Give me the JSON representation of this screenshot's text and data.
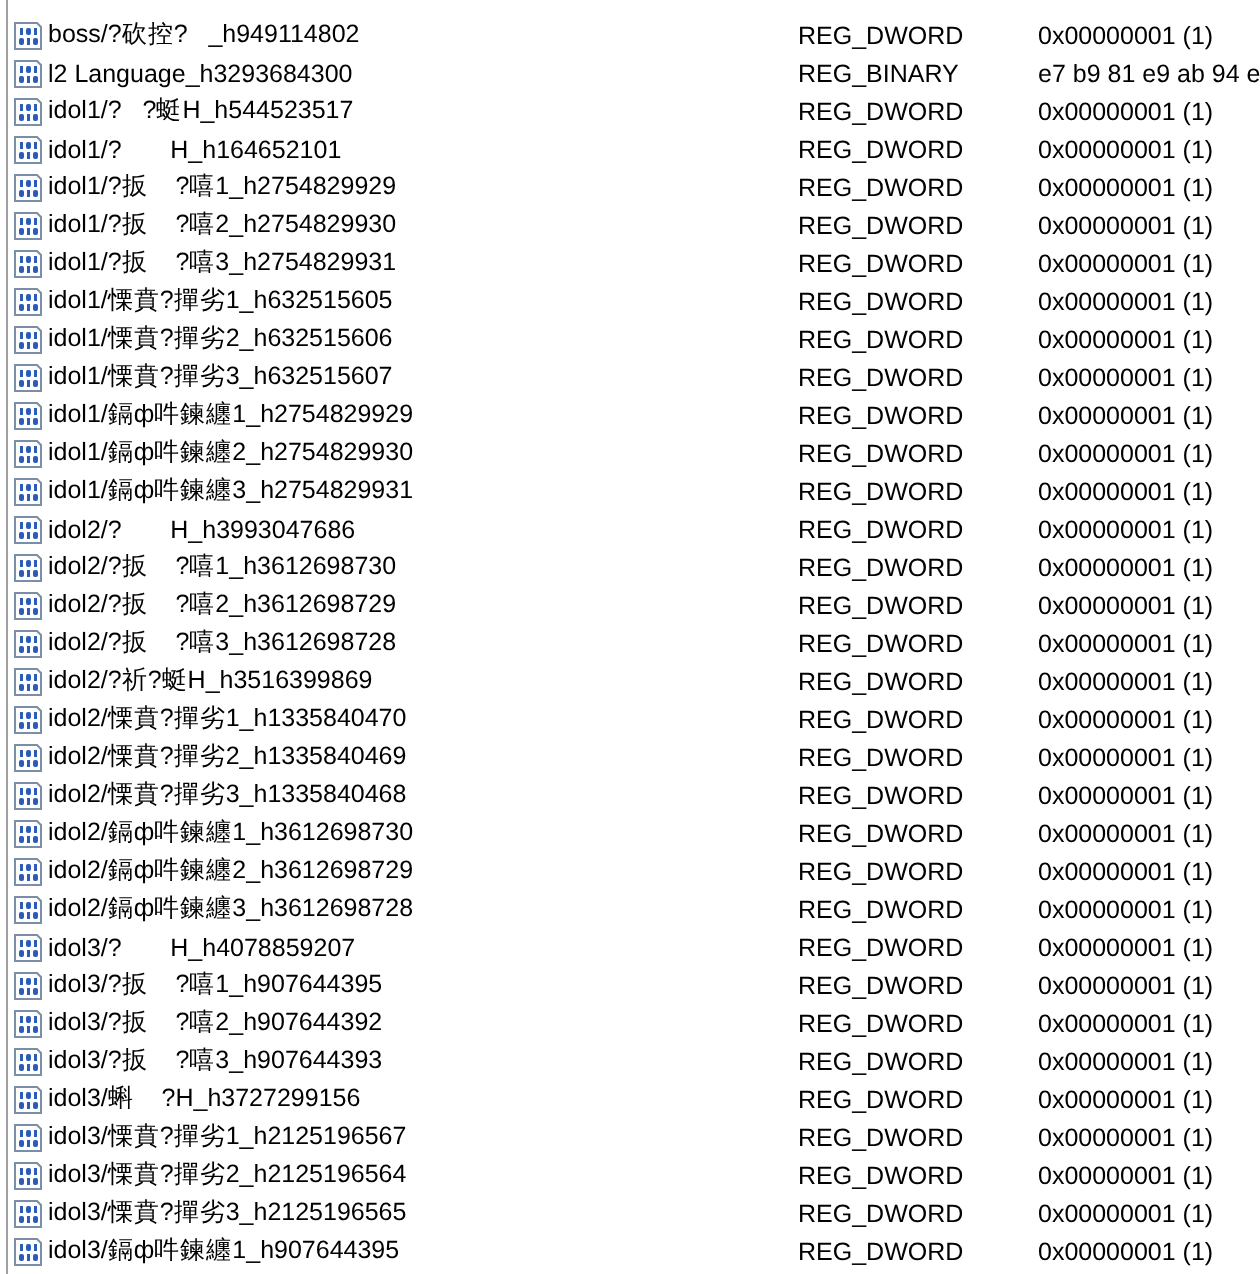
{
  "values": [
    {
      "name": "boss/?砍控?   _h949114802",
      "type": "REG_DWORD",
      "data": "0x00000001 (1)"
    },
    {
      "name": "l2 Language_h3293684300",
      "type": "REG_BINARY",
      "data": "e7 b9 81 e9 ab 94 e"
    },
    {
      "name": "idol1/?   ?蜓H_h544523517",
      "type": "REG_DWORD",
      "data": "0x00000001 (1)"
    },
    {
      "name": "idol1/?       H_h164652101",
      "type": "REG_DWORD",
      "data": "0x00000001 (1)"
    },
    {
      "name": "idol1/?扳    ?嘻1_h2754829929",
      "type": "REG_DWORD",
      "data": "0x00000001 (1)"
    },
    {
      "name": "idol1/?扳    ?嘻2_h2754829930",
      "type": "REG_DWORD",
      "data": "0x00000001 (1)"
    },
    {
      "name": "idol1/?扳    ?嘻3_h2754829931",
      "type": "REG_DWORD",
      "data": "0x00000001 (1)"
    },
    {
      "name": "idol1/慄賁?撣劣1_h632515605",
      "type": "REG_DWORD",
      "data": "0x00000001 (1)"
    },
    {
      "name": "idol1/慄賁?撣劣2_h632515606",
      "type": "REG_DWORD",
      "data": "0x00000001 (1)"
    },
    {
      "name": "idol1/慄賁?撣劣3_h632515607",
      "type": "REG_DWORD",
      "data": "0x00000001 (1)"
    },
    {
      "name": "idol1/鎘ф吽鍊纏1_h2754829929",
      "type": "REG_DWORD",
      "data": "0x00000001 (1)"
    },
    {
      "name": "idol1/鎘ф吽鍊纏2_h2754829930",
      "type": "REG_DWORD",
      "data": "0x00000001 (1)"
    },
    {
      "name": "idol1/鎘ф吽鍊纏3_h2754829931",
      "type": "REG_DWORD",
      "data": "0x00000001 (1)"
    },
    {
      "name": "idol2/?       H_h3993047686",
      "type": "REG_DWORD",
      "data": "0x00000001 (1)"
    },
    {
      "name": "idol2/?扳    ?嘻1_h3612698730",
      "type": "REG_DWORD",
      "data": "0x00000001 (1)"
    },
    {
      "name": "idol2/?扳    ?嘻2_h3612698729",
      "type": "REG_DWORD",
      "data": "0x00000001 (1)"
    },
    {
      "name": "idol2/?扳    ?嘻3_h3612698728",
      "type": "REG_DWORD",
      "data": "0x00000001 (1)"
    },
    {
      "name": "idol2/?祈?蜓H_h3516399869",
      "type": "REG_DWORD",
      "data": "0x00000001 (1)"
    },
    {
      "name": "idol2/慄賁?撣劣1_h1335840470",
      "type": "REG_DWORD",
      "data": "0x00000001 (1)"
    },
    {
      "name": "idol2/慄賁?撣劣2_h1335840469",
      "type": "REG_DWORD",
      "data": "0x00000001 (1)"
    },
    {
      "name": "idol2/慄賁?撣劣3_h1335840468",
      "type": "REG_DWORD",
      "data": "0x00000001 (1)"
    },
    {
      "name": "idol2/鎘ф吽鍊纏1_h3612698730",
      "type": "REG_DWORD",
      "data": "0x00000001 (1)"
    },
    {
      "name": "idol2/鎘ф吽鍊纏2_h3612698729",
      "type": "REG_DWORD",
      "data": "0x00000001 (1)"
    },
    {
      "name": "idol2/鎘ф吽鍊纏3_h3612698728",
      "type": "REG_DWORD",
      "data": "0x00000001 (1)"
    },
    {
      "name": "idol3/?       H_h4078859207",
      "type": "REG_DWORD",
      "data": "0x00000001 (1)"
    },
    {
      "name": "idol3/?扳    ?嘻1_h907644395",
      "type": "REG_DWORD",
      "data": "0x00000001 (1)"
    },
    {
      "name": "idol3/?扳    ?嘻2_h907644392",
      "type": "REG_DWORD",
      "data": "0x00000001 (1)"
    },
    {
      "name": "idol3/?扳    ?嘻3_h907644393",
      "type": "REG_DWORD",
      "data": "0x00000001 (1)"
    },
    {
      "name": "idol3/蝌    ?H_h3727299156",
      "type": "REG_DWORD",
      "data": "0x00000001 (1)"
    },
    {
      "name": "idol3/慄賁?撣劣1_h2125196567",
      "type": "REG_DWORD",
      "data": "0x00000001 (1)"
    },
    {
      "name": "idol3/慄賁?撣劣2_h2125196564",
      "type": "REG_DWORD",
      "data": "0x00000001 (1)"
    },
    {
      "name": "idol3/慄賁?撣劣3_h2125196565",
      "type": "REG_DWORD",
      "data": "0x00000001 (1)"
    },
    {
      "name": "idol3/鎘ф吽鍊纏1_h907644395",
      "type": "REG_DWORD",
      "data": "0x00000001 (1)"
    }
  ]
}
